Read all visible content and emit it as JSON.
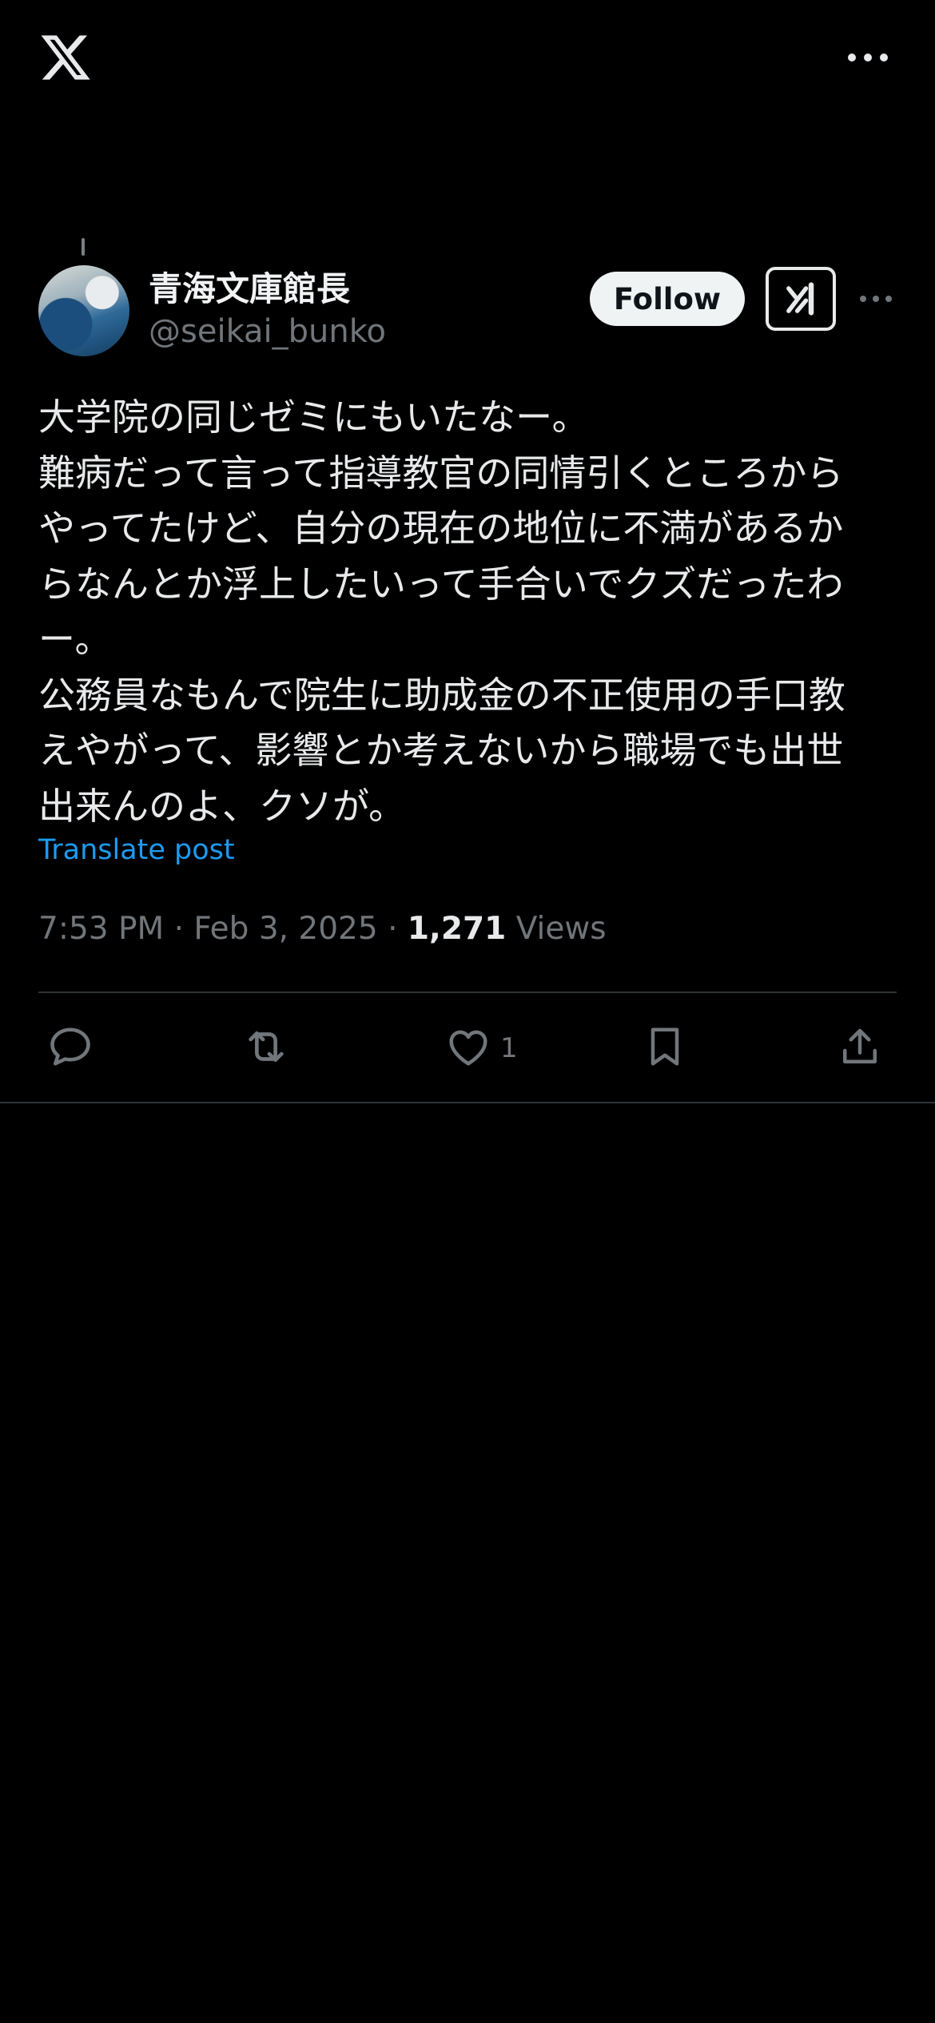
{
  "header": {
    "logo_icon": "x-logo-icon",
    "more_icon": "more-horizontal-icon"
  },
  "post": {
    "author": {
      "display_name": "青海文庫館長",
      "handle": "@seikai_bunko"
    },
    "follow_label": "Follow",
    "grok_icon": "grok-icon",
    "more_icon": "more-horizontal-icon",
    "text_lines": [
      "大学院の同じゼミにもいたなー。",
      "難病だって言って指導教官の同情引くところから",
      "やってたけど、自分の現在の地位に不満があるか",
      "らなんとか浮上したいって手合いでクズだったわ",
      "ー。",
      "公務員なもんで院生に助成金の不正使用の手口教",
      "えやがって、影響とか考えないから職場でも出世",
      "出来んのよ、クソが。"
    ],
    "translate_label": "Translate post",
    "time": "7:53 PM",
    "separator": "·",
    "date": "Feb 3, 2025",
    "views_count": "1,271",
    "views_label": "Views"
  },
  "actions": {
    "reply_icon": "reply-icon",
    "retweet_icon": "retweet-icon",
    "like_icon": "heart-icon",
    "like_count": "1",
    "bookmark_icon": "bookmark-icon",
    "share_icon": "share-icon"
  },
  "colors": {
    "background": "#000000",
    "text": "#e7e9ea",
    "secondary": "#71767b",
    "link": "#1d9bf0",
    "divider": "#2f3336"
  }
}
